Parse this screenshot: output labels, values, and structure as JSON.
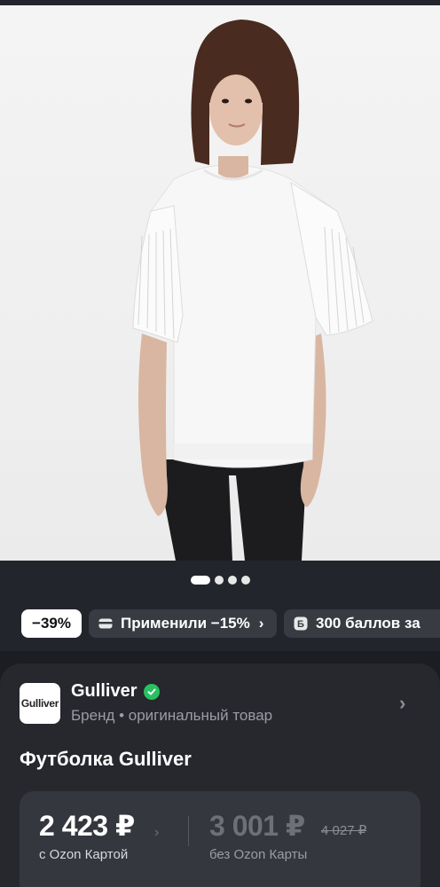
{
  "gallery": {
    "image_alt": "Girl wearing white t-shirt with pleated sleeves",
    "dots_total": 4,
    "active_index": 0
  },
  "chips": {
    "discount": "−39%",
    "applied": "Применили −15%",
    "applied_icon": "card-icon",
    "points": "300 баллов за",
    "points_icon": "bonus-b-icon"
  },
  "brand": {
    "logo_text": "Gulliver",
    "name": "Gulliver",
    "subtitle": "Бренд • оригинальный товар"
  },
  "product": {
    "title": "Футболка Gulliver"
  },
  "price": {
    "ozon_card_price": "2 423 ₽",
    "ozon_card_label": "с Ozon Картой",
    "regular_price": "3 001 ₽",
    "old_price": "4 027 ₽",
    "regular_label": "без Ozon Карты"
  },
  "colors": {
    "background": "#1b1d22",
    "verified": "#27c25f"
  }
}
